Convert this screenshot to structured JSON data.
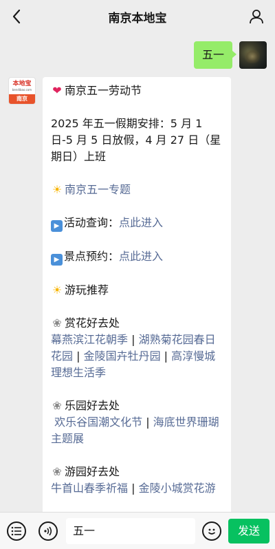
{
  "header": {
    "title": "南京本地宝"
  },
  "outgoing": {
    "text": "五一"
  },
  "bot": {
    "logo_top": "本地宝",
    "logo_sub": "bendibao.com",
    "logo_city": "南京"
  },
  "message": {
    "heading": "南京五一劳动节",
    "schedule": "2025 年五一假期安排：5 月 1 日-5 月 5 日放假，4 月 27 日（星期日）上班",
    "special_topic": "南京五一专题",
    "activity_label": "活动查询：",
    "activity_link": "点此进入",
    "scenic_label": "景点预约：",
    "scenic_link": "点此进入",
    "recommend": "游玩推荐",
    "flower_title": "赏花好去处",
    "flower_links": [
      "幕燕滨江花朝季",
      "湖熟菊花园春日花园",
      "金陵国卉牡丹园",
      "高淳慢城理想生活季"
    ],
    "park_title": "乐园好去处",
    "park_links": [
      "欢乐谷国潮文化节",
      "海底世界珊瑚主题展"
    ],
    "garden_title": "游园好去处",
    "garden_links": [
      "牛首山春季祈福",
      "金陵小城赏花游"
    ]
  },
  "footer": {
    "input_value": "五一",
    "send_label": "发送"
  },
  "colors": {
    "background": "#ededed",
    "outgoing_bubble": "#95ec69",
    "link": "#576b95",
    "send_button": "#07c160"
  },
  "icons": [
    "back-arrow-icon",
    "user-icon",
    "heart-icon",
    "sun-icon",
    "play-icon",
    "flower-icon",
    "list-icon",
    "voice-icon",
    "emoji-icon"
  ]
}
